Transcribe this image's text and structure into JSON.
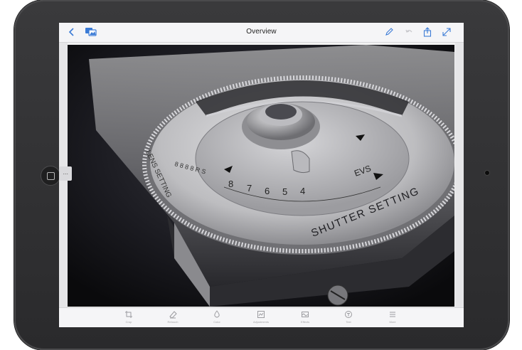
{
  "app": {
    "title": "Overview"
  },
  "topbar": {
    "back_icon": "chevron-left-icon",
    "library_icon": "photos-library-icon",
    "edit_icon": "pencil-icon",
    "undo_icon": "undo-icon",
    "share_icon": "share-icon",
    "fullscreen_icon": "expand-icon",
    "accent_color": "#3b7bd6"
  },
  "photo": {
    "description_text": {
      "dial_numbers": [
        "8",
        "7",
        "6",
        "5",
        "4"
      ],
      "ev_label": "EVS",
      "ring_label": "SHUTTER SETTING",
      "left_arc_text": "LENS SETTING",
      "left_small": "8 8 8 8 R S"
    }
  },
  "bottombar": {
    "items": [
      {
        "icon": "crop-icon",
        "label": "Crop"
      },
      {
        "icon": "eraser-icon",
        "label": "Retouch"
      },
      {
        "icon": "drop-icon",
        "label": "Color"
      },
      {
        "icon": "adjust-icon",
        "label": "Adjustments"
      },
      {
        "icon": "frame-icon",
        "label": "Effects"
      },
      {
        "icon": "text-icon",
        "label": "Text"
      },
      {
        "icon": "menu-icon",
        "label": "More"
      }
    ]
  },
  "side_handle": {
    "label": "···"
  }
}
